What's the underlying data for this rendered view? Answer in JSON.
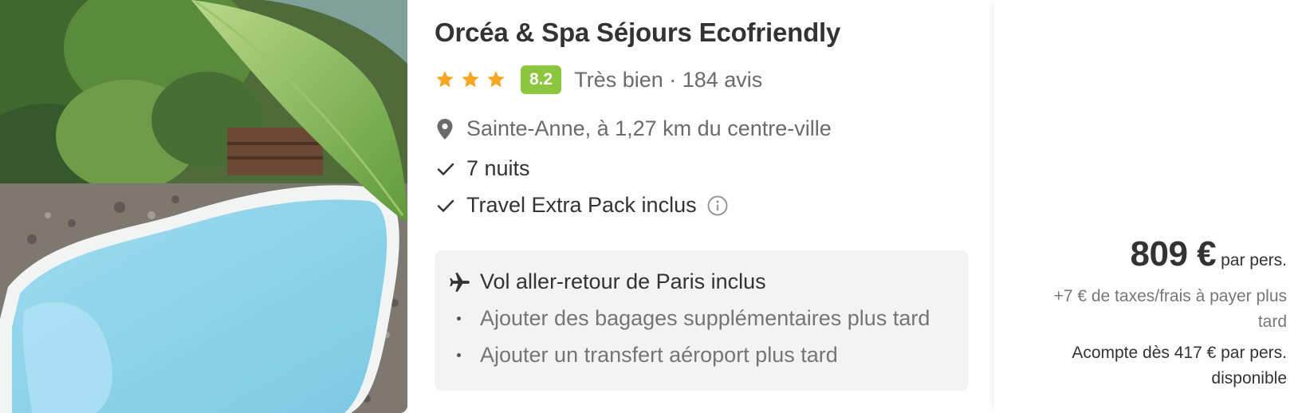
{
  "hotel": {
    "title": "Orcéa & Spa Séjours Ecofriendly",
    "stars": 3,
    "score": "8.2",
    "rating_text": "Très bien · 184 avis",
    "location": "Sainte-Anne, à 1,27 km du centre-ville",
    "features": [
      "7 nuits",
      "Travel Extra Pack inclus"
    ]
  },
  "flight": {
    "title": "Vol aller-retour de Paris inclus",
    "options": [
      "Ajouter des bagages supplémentaires plus tard",
      "Ajouter un transfert aéroport plus tard"
    ]
  },
  "pricing": {
    "price": "809 €",
    "per_person": "par pers.",
    "taxes": "+7 € de taxes/frais à payer plus tard",
    "deposit": "Acompte dès 417 € par pers. disponible"
  },
  "colors": {
    "star": "#f5a623",
    "score_badge": "#8cc63f",
    "flight_box": "#f3f3f3"
  },
  "icons": {
    "star": "star-icon",
    "location": "location-pin-icon",
    "check": "check-icon",
    "info": "info-icon",
    "plane": "plane-icon"
  }
}
